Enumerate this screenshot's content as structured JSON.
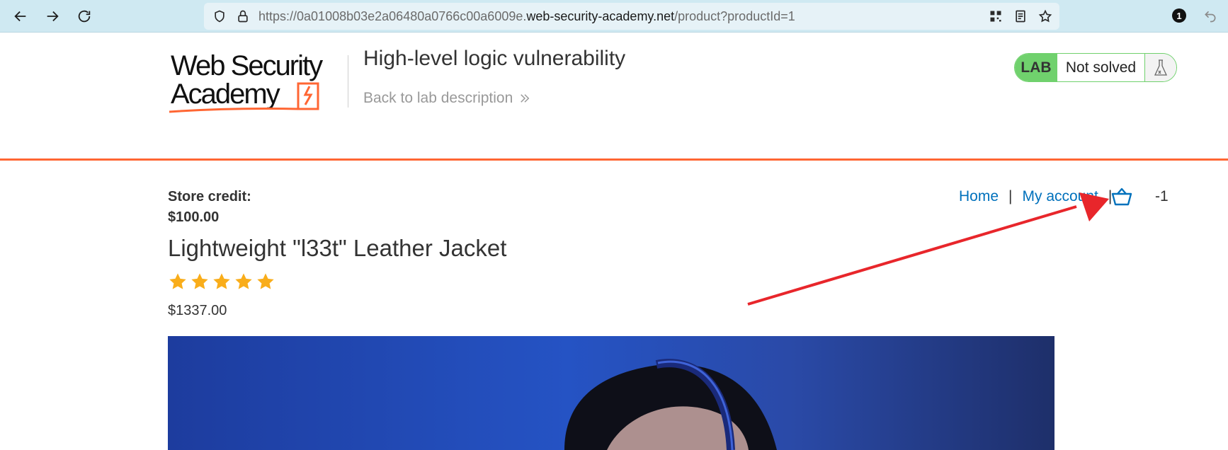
{
  "browser": {
    "url_prefix": "https://0a01008b03e2a06480a0766c00a6009e.",
    "url_domain": "web-security-academy.net",
    "url_path": "/product?productId=1",
    "extension_badge": "1"
  },
  "lab": {
    "logo_line1": "Web Security",
    "logo_line2": "Academy",
    "title": "High-level logic vulnerability",
    "back_link": "Back to lab description",
    "status_tag": "LAB",
    "status_text": "Not solved"
  },
  "store": {
    "credit_label": "Store credit:",
    "credit_value": "$100.00",
    "nav": {
      "home": "Home",
      "separator": "|",
      "my_account": "My account"
    },
    "cart_count": "-1"
  },
  "product": {
    "title": "Lightweight \"l33t\" Leather Jacket",
    "rating": 5,
    "rating_max": 5,
    "price": "$1337.00"
  },
  "colors": {
    "accent_orange": "#ff6633",
    "link_blue": "#0071bc",
    "lab_green": "#70d16d",
    "star_gold": "#f9ad1a",
    "annotation_red": "#e8262b"
  },
  "icons": {
    "back": "arrow-left-icon",
    "forward": "arrow-right-icon",
    "reload": "reload-icon",
    "shield": "shield-icon",
    "lock": "lock-icon",
    "qr": "qr-code-icon",
    "reader": "reader-mode-icon",
    "bookmark": "star-bookmark-icon",
    "cart": "shopping-basket-icon",
    "flask": "flask-icon"
  }
}
